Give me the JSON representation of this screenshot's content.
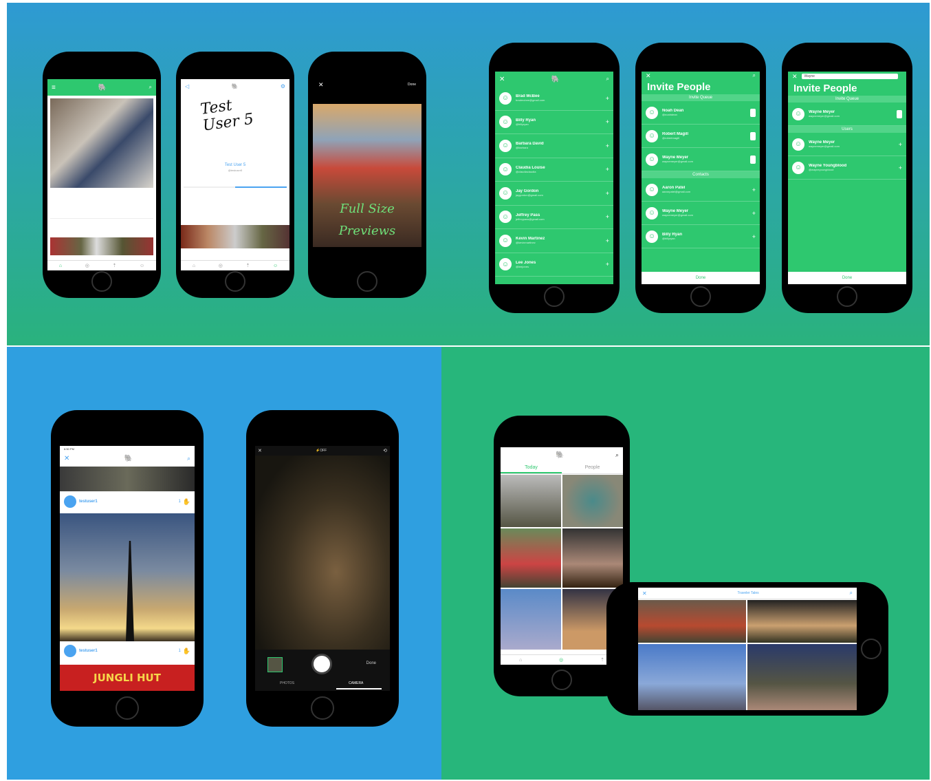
{
  "colors": {
    "green": "#2ec86f",
    "blue": "#2f9fe0",
    "accent": "#4aa3f0"
  },
  "p2": {
    "handwriting": "Test User 5",
    "user_name": "Test User 5",
    "user_handle": "@testuser5"
  },
  "p3": {
    "done": "Done",
    "caption_line1": "Full Size",
    "caption_line2": "Previews"
  },
  "invite_list": [
    {
      "name": "Brad McBee",
      "sub": "bradmcbee@gmail.com"
    },
    {
      "name": "Billy Ryan",
      "sub": "@billyryan"
    },
    {
      "name": "Barbara David",
      "sub": "@barbara"
    },
    {
      "name": "Claudia Louise",
      "sub": "@claudiaclaudia"
    },
    {
      "name": "Jay Gordon",
      "sub": "jaygordon@gmail.com"
    },
    {
      "name": "Jeffrey Pass",
      "sub": "jeffreypass@gmail.com"
    },
    {
      "name": "Kevin Martinez",
      "sub": "@kevinmartinez"
    },
    {
      "name": "Lee Jones",
      "sub": "@leejones"
    }
  ],
  "p5": {
    "title": "Invite People",
    "queue_header": "Invite Queue",
    "contacts_header": "Contacts",
    "done": "Done",
    "queue": [
      {
        "name": "Noah Dean",
        "sub": "@noahdean"
      },
      {
        "name": "Robert Magill",
        "sub": "@robertmagill"
      },
      {
        "name": "Wayne Meyer",
        "sub": "waynemeyer@gmail.com"
      }
    ],
    "contacts": [
      {
        "name": "Aaron Patel",
        "sub": "aaronpatel@gmail.com"
      },
      {
        "name": "Wayne Meyer",
        "sub": "waynemeyer@gmail.com"
      },
      {
        "name": "Billy Ryan",
        "sub": "@billyryan"
      }
    ]
  },
  "p6": {
    "search_value": "Wayne",
    "title": "Invite People",
    "queue_header": "Invite Queue",
    "users_header": "Users",
    "done": "Done",
    "queue": [
      {
        "name": "Wayne Meyer",
        "sub": "waynemeyer@gmail.com"
      }
    ],
    "users": [
      {
        "name": "Wayne Meyer",
        "sub": "waynemeyer@gmail.com"
      },
      {
        "name": "Wayne Youngblood",
        "sub": "@wayneyoungblood"
      }
    ]
  },
  "p7": {
    "time": "6:50 PM",
    "user": "testuser1",
    "count": "1",
    "sign": "JUNGLI HUT"
  },
  "p8": {
    "flash": "OFF",
    "done": "Done",
    "tab_photos": "PHOTOS",
    "tab_camera": "CAMERA"
  },
  "p9": {
    "tab_today": "Today",
    "tab_people": "People"
  },
  "p10": {
    "title": "Traveler Tales"
  }
}
